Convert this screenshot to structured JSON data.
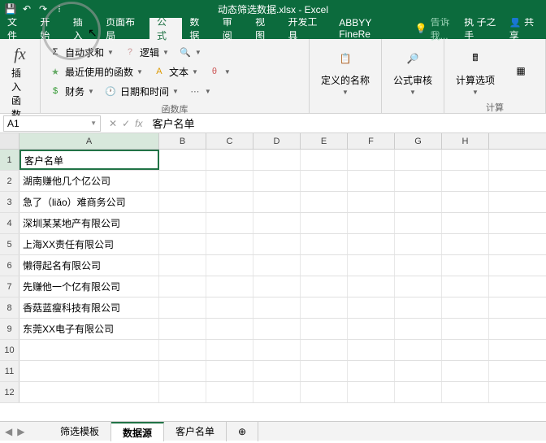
{
  "title": "动态筛选数据.xlsx - Excel",
  "tabs": {
    "file": "文件",
    "home": "开始",
    "insert": "插入",
    "layout": "页面布局",
    "formula": "公式",
    "data": "数据",
    "review": "审阅",
    "view": "视图",
    "dev": "开发工具",
    "abbyy": "ABBYY FineRe"
  },
  "tell": "告诉我...",
  "user": "执 子之手",
  "share": "共享",
  "ribbon": {
    "insertFn": "插入函数",
    "autosum": "自动求和",
    "recent": "最近使用的函数",
    "financial": "财务",
    "logical": "逻辑",
    "text": "文本",
    "datetime": "日期和时间",
    "funclib": "函数库",
    "defName": "定义的名称",
    "audit": "公式审核",
    "calcOpt": "计算选项",
    "calc": "计算"
  },
  "namebox": "A1",
  "formulaValue": "客户名单",
  "cols": [
    "A",
    "B",
    "C",
    "D",
    "E",
    "F",
    "G",
    "H"
  ],
  "rows": [
    {
      "n": 1,
      "a": "客户名单"
    },
    {
      "n": 2,
      "a": "湖南赚他几个亿公司"
    },
    {
      "n": 3,
      "a": "急了（liǎo）难商务公司"
    },
    {
      "n": 4,
      "a": "深圳某某地产有限公司"
    },
    {
      "n": 5,
      "a": "上海XX责任有限公司"
    },
    {
      "n": 6,
      "a": "懒得起名有限公司"
    },
    {
      "n": 7,
      "a": "先赚他一个亿有限公司"
    },
    {
      "n": 8,
      "a": "香菇蓝瘦科技有限公司"
    },
    {
      "n": 9,
      "a": "东莞XX电子有限公司"
    },
    {
      "n": 10,
      "a": ""
    },
    {
      "n": 11,
      "a": ""
    },
    {
      "n": 12,
      "a": ""
    }
  ],
  "sheets": {
    "s1": "筛选模板",
    "s2": "数据源",
    "s3": "客户名单"
  }
}
